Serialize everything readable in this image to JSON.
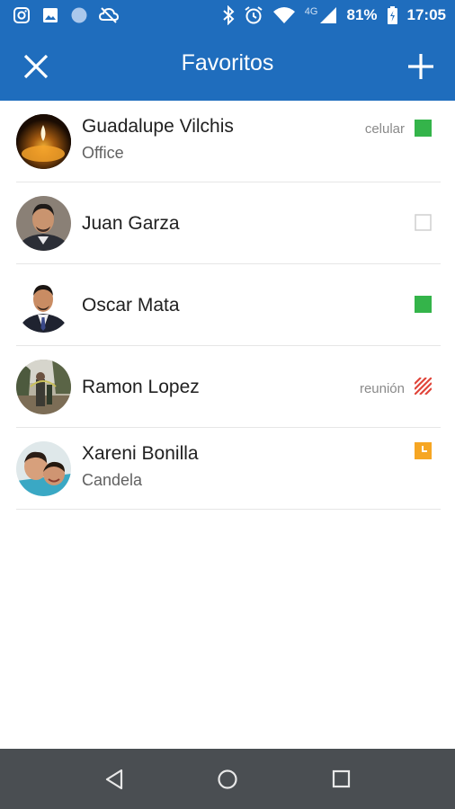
{
  "status_bar": {
    "battery": "81%",
    "time": "17:05",
    "network": "4G",
    "left_icons": [
      "instagram-icon",
      "image-icon",
      "circle-icon",
      "cloud-off-icon"
    ],
    "right_icons": [
      "bluetooth-icon",
      "alarm-icon",
      "wifi-icon",
      "signal-icon",
      "battery-icon"
    ]
  },
  "app_bar": {
    "title": "Favoritos",
    "left_action": "close-icon",
    "right_action": "add-icon"
  },
  "contacts": [
    {
      "name": "Guadalupe Vilchis",
      "subtitle": "Office",
      "status_label": "celular",
      "presence": "available",
      "avatar": "candle-photo"
    },
    {
      "name": "Juan Garza",
      "subtitle": "",
      "status_label": "",
      "presence": "offline",
      "avatar": "man-photo"
    },
    {
      "name": "Oscar Mata",
      "subtitle": "",
      "status_label": "",
      "presence": "available",
      "avatar": "man-suit-photo"
    },
    {
      "name": "Ramon Lopez",
      "subtitle": "",
      "status_label": "reunión",
      "presence": "busy",
      "avatar": "outdoor-photo"
    },
    {
      "name": "Xareni Bonilla",
      "subtitle": "Candela",
      "status_label": "",
      "presence": "away",
      "avatar": "kids-photo"
    }
  ],
  "colors": {
    "primary": "#1f6dbd",
    "available": "#34b44a",
    "busy": "#e0453a",
    "away": "#f6a623",
    "navbar": "#4a4e52"
  },
  "nav_bar": {
    "buttons": [
      "back-icon",
      "home-icon",
      "recents-icon"
    ]
  }
}
